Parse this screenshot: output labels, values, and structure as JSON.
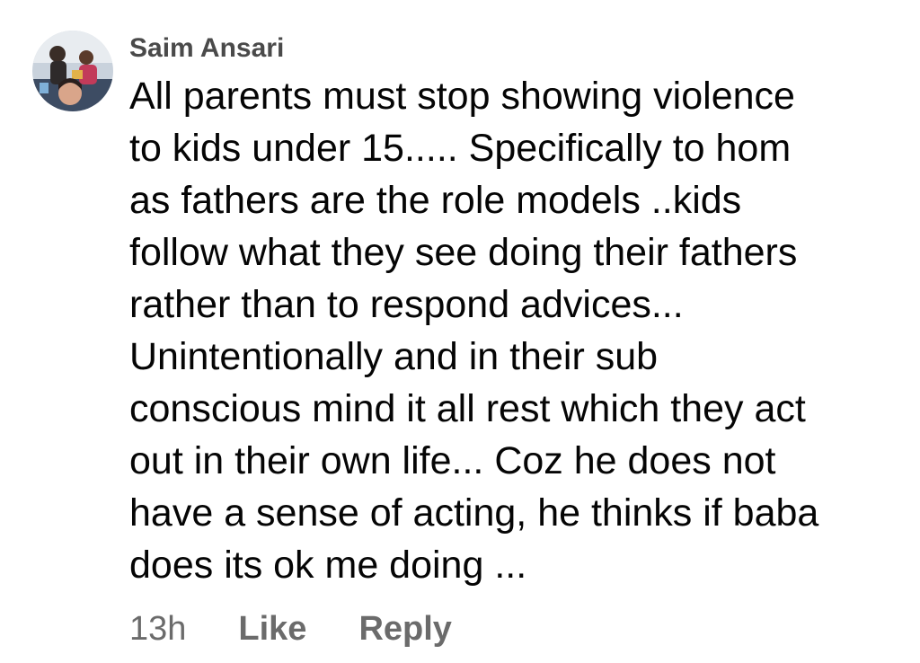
{
  "comment": {
    "author": "Saim Ansari",
    "lines": [
      "All parents must stop showing violence",
      "to kids under 15..... Specifically to hom",
      "as fathers are the role models ..kids",
      "follow what they see doing their fathers",
      "rather than to respond advices...",
      "Unintentionally and in their sub",
      "conscious mind it all rest which they act",
      "out in their own life... Coz he does not",
      "have a sense of acting, he thinks if baba",
      "does its ok me doing ..."
    ],
    "timestamp": "13h",
    "like_label": "Like",
    "reply_label": "Reply"
  },
  "colors": {
    "author": "#4a4a4a",
    "text": "#050505",
    "meta": "#6b6b6b"
  }
}
